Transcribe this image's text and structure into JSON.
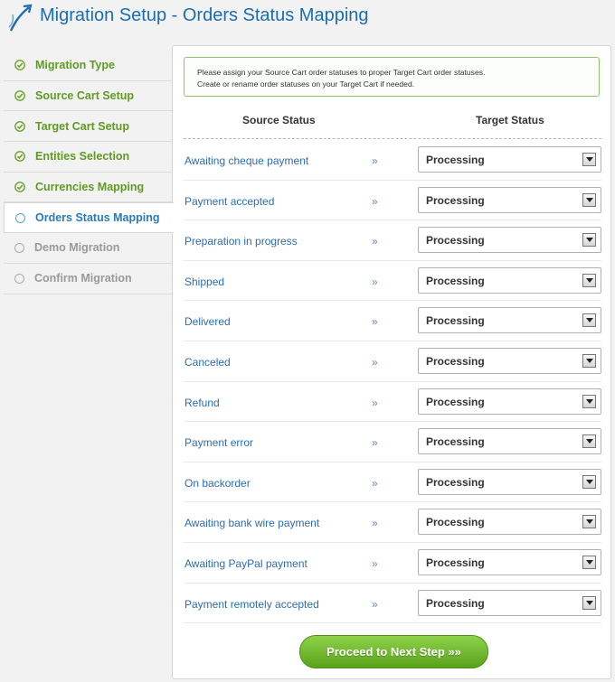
{
  "title": "Migration Setup - Orders Status Mapping",
  "logo_icon": "diagonal-arrow-logo",
  "colors": {
    "accent": "#1a6db0",
    "done": "#5f9a22",
    "pending": "#999999",
    "button": "#6cb52e"
  },
  "steps": [
    {
      "label": "Migration Type",
      "state": "done",
      "icon": "check-icon"
    },
    {
      "label": "Source Cart Setup",
      "state": "done",
      "icon": "check-icon"
    },
    {
      "label": "Target Cart Setup",
      "state": "done",
      "icon": "check-icon"
    },
    {
      "label": "Entities Selection",
      "state": "done",
      "icon": "check-icon"
    },
    {
      "label": "Currencies Mapping",
      "state": "done",
      "icon": "check-icon"
    },
    {
      "label": "Orders Status Mapping",
      "state": "active",
      "icon": "circle-icon"
    },
    {
      "label": "Demo Migration",
      "state": "pending",
      "icon": "circle-icon"
    },
    {
      "label": "Confirm Migration",
      "state": "pending",
      "icon": "circle-icon"
    }
  ],
  "notice": {
    "line1": "Please assign your Source Cart order statuses to proper Target Cart order statuses.",
    "line2": "Create or rename order statuses on your Target Cart if needed."
  },
  "columns": {
    "source": "Source Status",
    "target": "Target Status"
  },
  "arrow_glyph": "»",
  "mappings": [
    {
      "source": "Awaiting cheque payment",
      "target": "Processing"
    },
    {
      "source": "Payment accepted",
      "target": "Processing"
    },
    {
      "source": "Preparation in progress",
      "target": "Processing"
    },
    {
      "source": "Shipped",
      "target": "Processing"
    },
    {
      "source": "Delivered",
      "target": "Processing"
    },
    {
      "source": "Canceled",
      "target": "Processing"
    },
    {
      "source": "Refund",
      "target": "Processing"
    },
    {
      "source": "Payment error",
      "target": "Processing"
    },
    {
      "source": "On backorder",
      "target": "Processing"
    },
    {
      "source": "Awaiting bank wire payment",
      "target": "Processing"
    },
    {
      "source": "Awaiting PayPal payment",
      "target": "Processing"
    },
    {
      "source": "Payment remotely accepted",
      "target": "Processing"
    }
  ],
  "proceed_label": "Proceed to Next Step »»"
}
